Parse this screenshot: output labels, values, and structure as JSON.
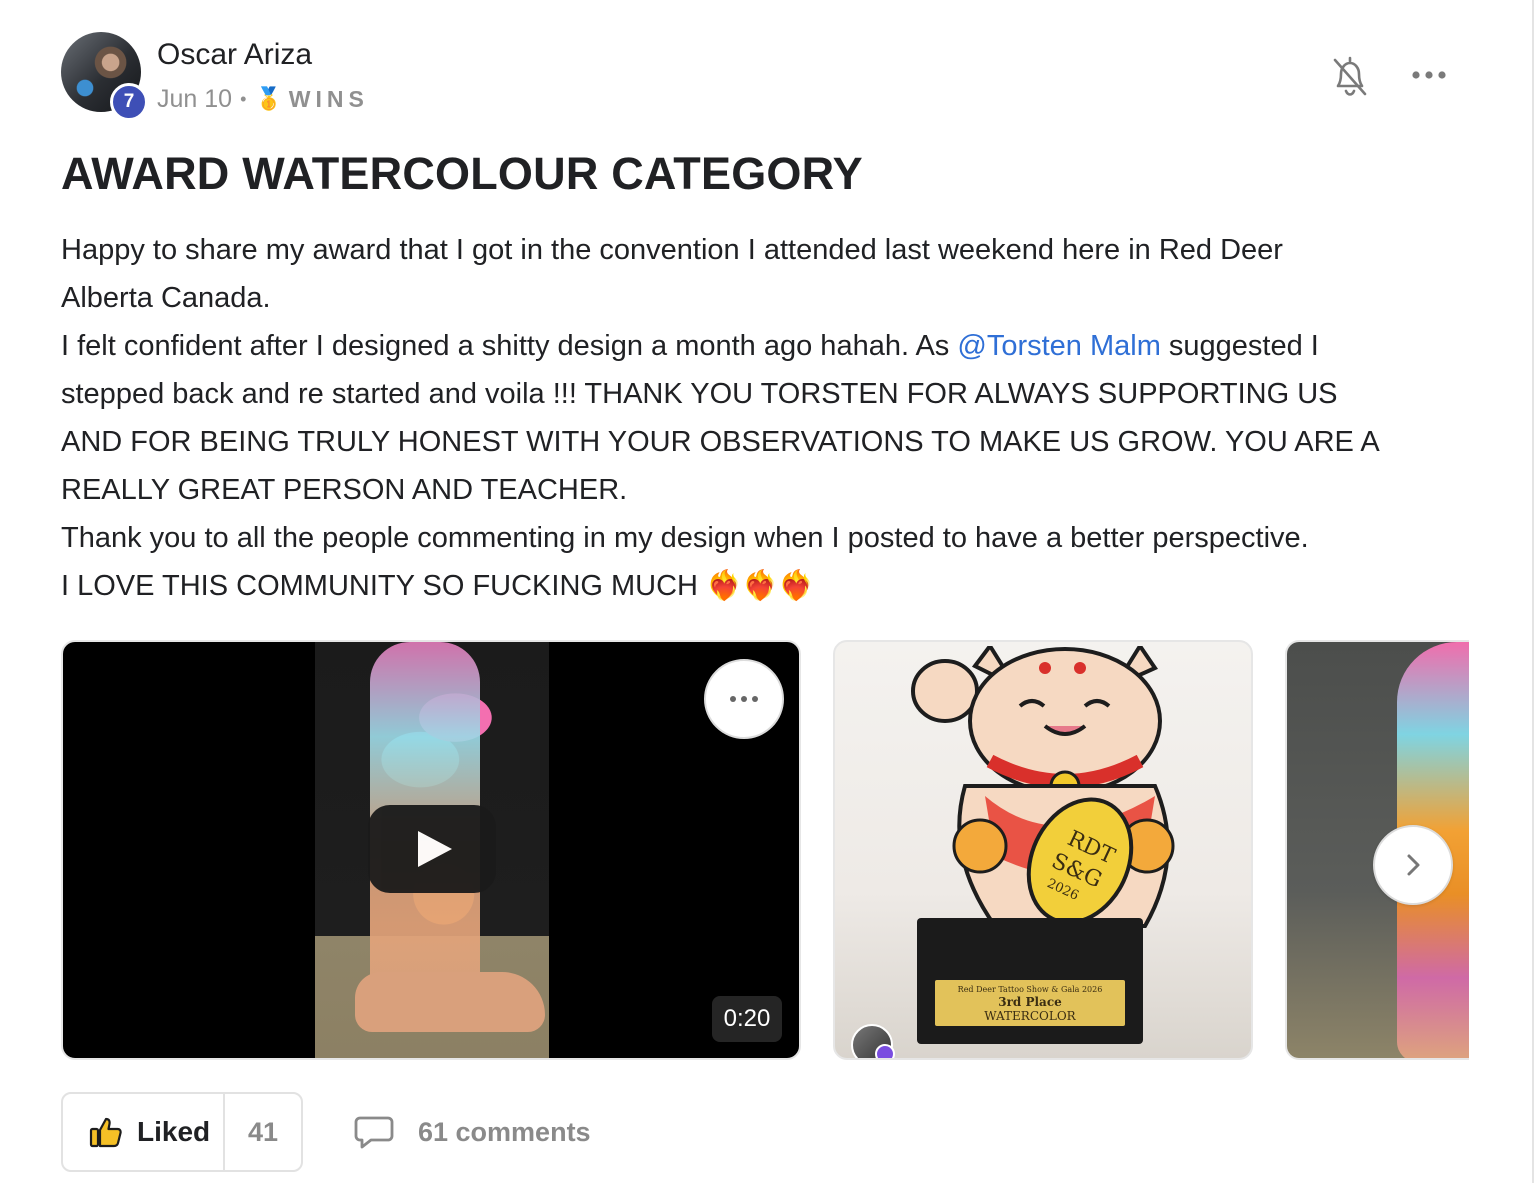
{
  "author": {
    "name": "Oscar Ariza",
    "level": "7"
  },
  "meta": {
    "date": "Jun 10",
    "separator": "•",
    "category_emoji": "🥇",
    "category": "WINS"
  },
  "post": {
    "title": "AWARD WATERCOLOUR CATEGORY",
    "line1": "Happy to share my award that I got in the convention I attended last weekend here in Red Deer",
    "line2": "Alberta Canada.",
    "line3_before": "I felt confident after I designed a shitty design a month ago hahah. As ",
    "mention": "@Torsten Malm",
    "line3_after": " suggested I",
    "line4": "stepped back and re started and voila !!! THANK YOU TORSTEN FOR ALWAYS SUPPORTING US",
    "line5": "AND FOR BEING TRULY HONEST WITH YOUR OBSERVATIONS TO MAKE US GROW. YOU ARE A",
    "line6": "REALLY GREAT PERSON AND TEACHER.",
    "line7": "Thank you to all the people commenting in my design when I posted to have a better perspective.",
    "line8": "I LOVE THIS COMMUNITY SO FUCKING MUCH ❤️‍🔥❤️‍🔥❤️‍🔥"
  },
  "media": {
    "video_duration": "0:20",
    "plaque_line1": "Red Deer Tattoo Show & Gala 2026",
    "plaque_line2": "3rd Place",
    "plaque_line3": "WATERCOLOR"
  },
  "footer": {
    "like_label": "Liked",
    "like_count": "41",
    "comments_label": "61 comments"
  },
  "icons": {
    "bell": "bell-off-icon",
    "more": "more-horizontal-icon",
    "thumbs_up": "thumbs-up-icon",
    "comment": "comment-icon",
    "play": "play-icon",
    "chevron": "chevron-right-icon"
  },
  "colors": {
    "mention": "#2f6fd6",
    "badge": "#3e4fb6",
    "muted": "#909090"
  }
}
